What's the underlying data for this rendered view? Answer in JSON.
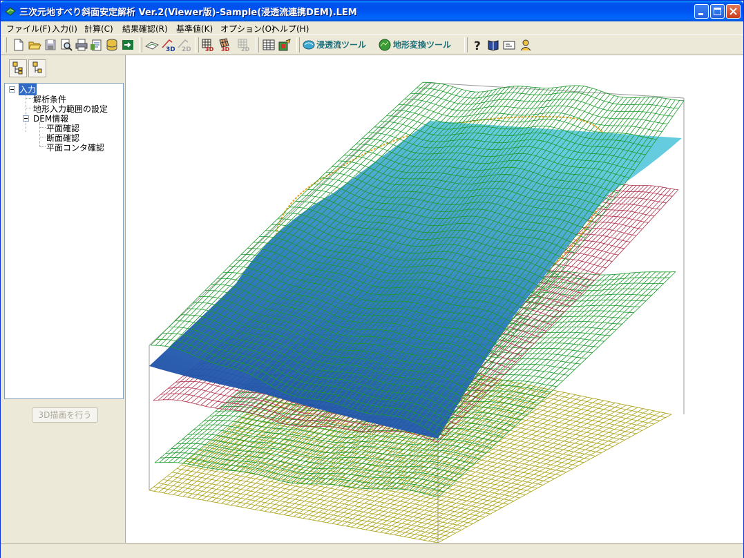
{
  "window": {
    "title": "三次元地すべり斜面安定解析 Ver.2(Viewer版)-Sample(浸透流連携DEM).LEM"
  },
  "menu": [
    "ファイル(F)",
    "入力(I)",
    "計算(C)",
    "結果確認(R)",
    "基準値(K)",
    "オプション(O)",
    "ヘルプ(H)"
  ],
  "toolbar": {
    "seepage_tool": "浸透流ツール",
    "terrain_tool": "地形変換ツール",
    "label_3d": "3D",
    "label_2d": "2D"
  },
  "tree": {
    "root": "入力",
    "items": [
      "解析条件",
      "地形入力範囲の設定",
      "DEM情報"
    ],
    "dem_children": [
      "平面確認",
      "断面確認",
      "平面コンタ確認"
    ]
  },
  "left_panel": {
    "draw_button": "3D描画を行う"
  },
  "colors": {
    "title_blue": "#0053ee",
    "grid_green": "#1a9a2a",
    "grid_red": "#b0304a",
    "grid_yellow": "#a8a010",
    "grid_orange": "#e8a020",
    "surface_top": "#5cc9dc",
    "surface_bottom": "#1a3f9e"
  }
}
